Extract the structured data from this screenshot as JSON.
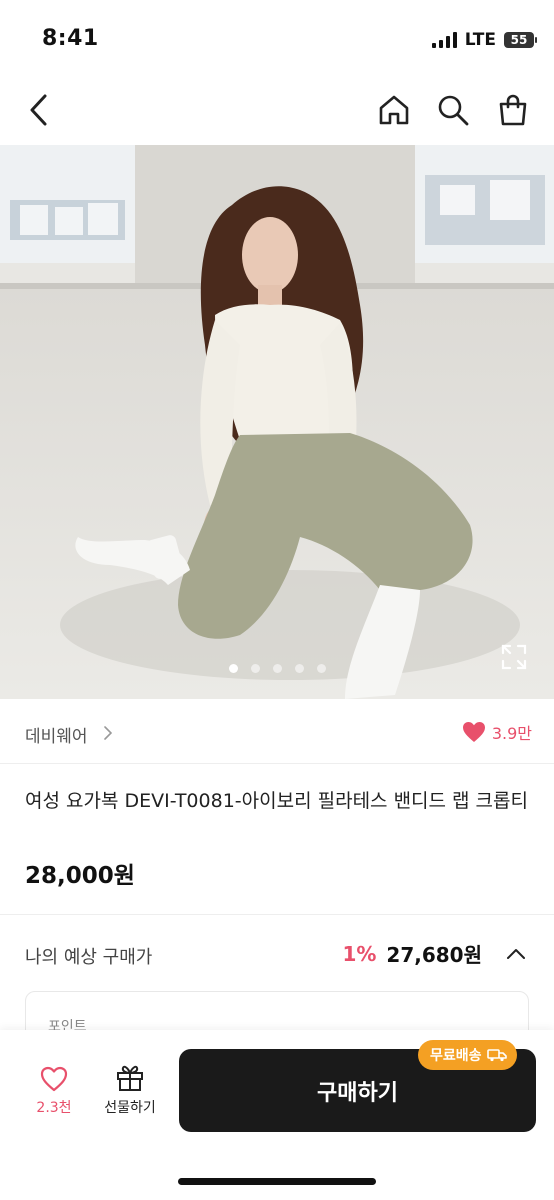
{
  "status_bar": {
    "time": "8:41",
    "network": "LTE",
    "battery": "55"
  },
  "nav": {
    "back_icon": "chevron-left-icon",
    "home_icon": "home-icon",
    "search_icon": "search-icon",
    "cart_icon": "shopping-bag-icon"
  },
  "gallery": {
    "image_count": 5,
    "active_index": 0,
    "expand_icon": "expand-icon"
  },
  "brand": {
    "name": "데비웨어",
    "chevron": ">",
    "likes": "3.9만"
  },
  "product": {
    "title": "여성 요가복 DEVI-T0081-아이보리 필라테스 밴디드 랩 크롭티",
    "price": "28,000원"
  },
  "expected_price": {
    "label": "나의 예상 구매가",
    "discount": "1%",
    "price": "27,680원"
  },
  "point": {
    "label": "포인트"
  },
  "bottom_bar": {
    "like_count": "2.3천",
    "gift_label": "선물하기",
    "buy_label": "구매하기",
    "free_shipping": "무료배송"
  },
  "colors": {
    "accent": "#e8506b",
    "button": "#1a1a1a",
    "badge": "#f4a023"
  }
}
